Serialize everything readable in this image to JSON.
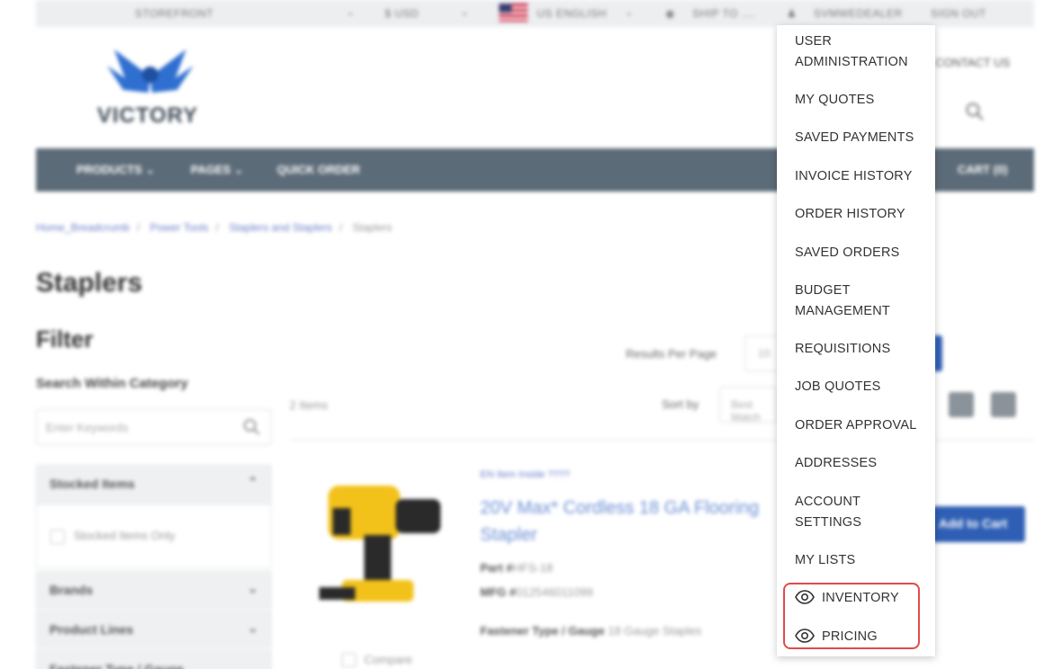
{
  "topbar": {
    "storefront": "STOREFRONT",
    "currency": "USD",
    "language": "US ENGLISH",
    "ship_to": "SHIP TO",
    "user_name": "SVMWEDEALER",
    "sign_out": "SIGN OUT"
  },
  "header": {
    "logo_text": "VICTORY",
    "contact": "CONTACT US"
  },
  "nav": {
    "products": "PRODUCTS",
    "pages": "PAGES",
    "quick_order": "QUICK ORDER",
    "cart": "CART (0)"
  },
  "breadcrumb": {
    "items": [
      "Home_Breadcrumb",
      "Power Tools",
      "Staplers and Staplers"
    ],
    "current": "Staplers"
  },
  "page": {
    "title": "Staplers"
  },
  "filter": {
    "title": "Filter",
    "search_label": "Search Within Category",
    "search_placeholder": "Enter Keywords",
    "facets": [
      {
        "label": "Stocked Items",
        "option": "Stocked Items Only"
      },
      {
        "label": "Brands"
      },
      {
        "label": "Product Lines"
      },
      {
        "label": "Fastener Type / Gauge"
      }
    ]
  },
  "results": {
    "per_page_label": "Results Per Page",
    "per_page_value": "10",
    "items_count": "2 Items",
    "sort_label": "Sort by",
    "sort_value": "Best Match"
  },
  "product": {
    "small_link": "EN Item Inside ????",
    "title": "20V Max* Cordless 18 GA Flooring Stapler",
    "part_label": "Part #",
    "part_value": "HFS-18",
    "mfg_label": "MFG #",
    "mfg_value": "012546011099",
    "fastener_label": "Fastener Type / Gauge",
    "fastener_value": "18 Gauge Staples",
    "compare": "Compare",
    "add_to_cart": "Add to Cart"
  },
  "dropdown": {
    "items": [
      "USER ADMINISTRATION",
      "MY QUOTES",
      "SAVED PAYMENTS",
      "INVOICE HISTORY",
      "ORDER HISTORY",
      "SAVED ORDERS",
      "BUDGET MANAGEMENT",
      "REQUISITIONS",
      "JOB QUOTES",
      "ORDER APPROVAL",
      "ADDRESSES",
      "ACCOUNT SETTINGS",
      "MY LISTS"
    ],
    "toggles": [
      "INVENTORY",
      "PRICING"
    ],
    "toggle_icon": "eye-icon",
    "highlight_color": "#e04b4b"
  },
  "colors": {
    "nav_bg": "#5c6b78",
    "accent_blue": "#2f5fb4",
    "link_blue": "#6b8fd6",
    "topbar_bg": "#eceef0"
  }
}
